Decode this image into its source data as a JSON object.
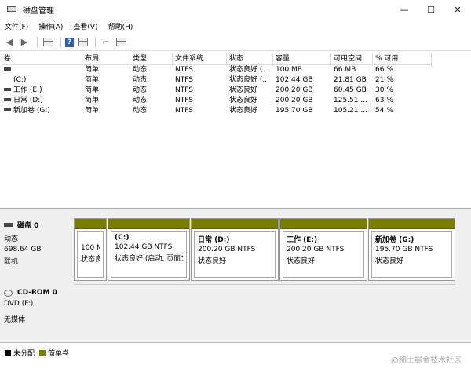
{
  "window": {
    "title": "磁盘管理",
    "buttons": {
      "minimize": "—",
      "maximize": "☐",
      "close": "✕"
    }
  },
  "menubar": [
    "文件(F)",
    "操作(A)",
    "查看(V)",
    "帮助(H)"
  ],
  "toolbar": {
    "icons": [
      "back-icon",
      "forward-icon",
      "show-pane-icon",
      "help-icon",
      "properties-icon",
      "connect-icon",
      "view-icon"
    ]
  },
  "table": {
    "headers": [
      "卷",
      "布局",
      "类型",
      "文件系统",
      "状态",
      "容量",
      "可用空间",
      "% 可用"
    ],
    "rows": [
      {
        "vol": "",
        "layout": "简单",
        "type": "动态",
        "fs": "NTFS",
        "status": "状态良好 (...",
        "cap": "100 MB",
        "free": "66 MB",
        "pct": "66 %"
      },
      {
        "vol": "(C:)",
        "layout": "简单",
        "type": "动态",
        "fs": "NTFS",
        "status": "状态良好 (...",
        "cap": "102.44 GB",
        "free": "21.81 GB",
        "pct": "21 %"
      },
      {
        "vol": "工作 (E:)",
        "layout": "简单",
        "type": "动态",
        "fs": "NTFS",
        "status": "状态良好",
        "cap": "200.20 GB",
        "free": "60.45 GB",
        "pct": "30 %"
      },
      {
        "vol": "日常 (D:)",
        "layout": "简单",
        "type": "动态",
        "fs": "NTFS",
        "status": "状态良好",
        "cap": "200.20 GB",
        "free": "125.51 ...",
        "pct": "63 %"
      },
      {
        "vol": "新加卷 (G:)",
        "layout": "简单",
        "type": "动态",
        "fs": "NTFS",
        "status": "状态良好",
        "cap": "195.70 GB",
        "free": "105.21 ...",
        "pct": "54 %"
      }
    ]
  },
  "disk0": {
    "title": "磁盘 0",
    "type": "动态",
    "size": "698.64 GB",
    "state": "联机",
    "partitions": [
      {
        "name": "",
        "size": "100 M",
        "status": "状态良"
      },
      {
        "name": "(C:)",
        "size": "102.44 GB NTFS",
        "status": "状态良好 (启动, 页面文"
      },
      {
        "name": "日常  (D:)",
        "size": "200.20 GB NTFS",
        "status": "状态良好"
      },
      {
        "name": "工作  (E:)",
        "size": "200.20 GB NTFS",
        "status": "状态良好"
      },
      {
        "name": "新加卷  (G:)",
        "size": "195.70 GB NTFS",
        "status": "状态良好"
      }
    ]
  },
  "cdrom0": {
    "title": "CD-ROM 0",
    "drive": "DVD (F:)",
    "media": "无媒体"
  },
  "legend": [
    {
      "label": "未分配",
      "color": "#000000"
    },
    {
      "label": "简单卷",
      "color": "#7a7e00"
    }
  ],
  "watermark": "@稀土掘金技术社区"
}
